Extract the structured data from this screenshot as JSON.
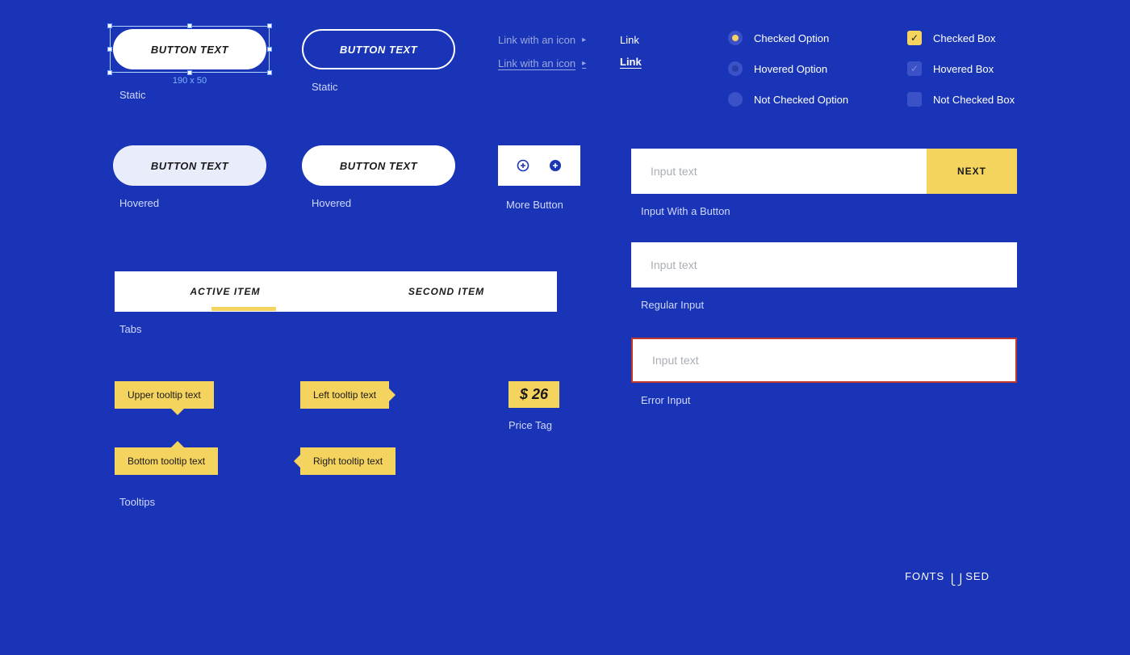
{
  "buttons": {
    "text": "BUTTON TEXT",
    "selection_size": "190 x 50",
    "labels": {
      "static": "Static",
      "hovered": "Hovered"
    }
  },
  "more_button": {
    "label": "More Button"
  },
  "links": {
    "icon": "Link with an icon",
    "plain": "Link"
  },
  "radio": {
    "checked": "Checked Option",
    "hovered": "Hovered Option",
    "unchecked": "Not Checked Option"
  },
  "checkbox": {
    "checked": "Checked Box",
    "hovered": "Hovered Box",
    "unchecked": "Not Checked Box"
  },
  "inputs": {
    "placeholder": "Input text",
    "next": "NEXT",
    "with_button": "Input With a Button",
    "regular": "Regular Input",
    "error": "Error Input"
  },
  "tabs": {
    "label": "Tabs",
    "items": [
      "ACTIVE ITEM",
      "SECOND ITEM"
    ]
  },
  "tooltips": {
    "label": "Tooltips",
    "upper": "Upper tooltip text",
    "bottom": "Bottom tooltip text",
    "left": "Left tooltip text",
    "right": "Right tooltip text"
  },
  "price": {
    "value": "$ 26",
    "label": "Price Tag"
  },
  "footer": {
    "fonts_used": "FONTS USED"
  }
}
